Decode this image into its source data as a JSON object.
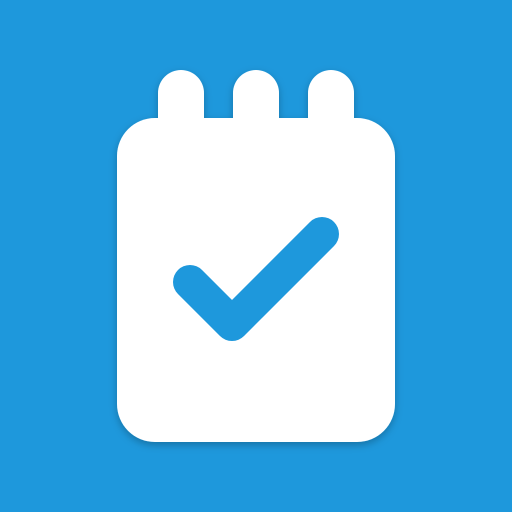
{
  "icon": {
    "semantic": "notepad-checkmark-icon",
    "colors": {
      "background": "#1e98dc",
      "notepad": "#ffffff",
      "checkmark": "#1e98dc",
      "shadow": "#0e5f94"
    }
  }
}
